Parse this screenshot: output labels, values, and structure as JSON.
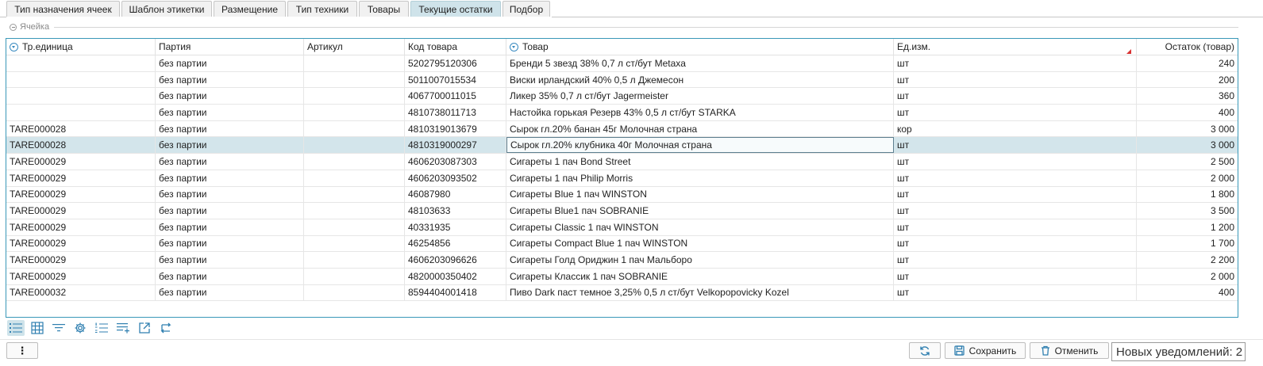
{
  "tabs": [
    {
      "label": "Тип назначения ячеек",
      "active": false
    },
    {
      "label": "Шаблон этикетки",
      "active": false
    },
    {
      "label": "Размещение",
      "active": false
    },
    {
      "label": "Тип техники",
      "active": false
    },
    {
      "label": "Товары",
      "active": false
    },
    {
      "label": "Текущие остатки",
      "active": true
    },
    {
      "label": "Подбор",
      "active": false
    }
  ],
  "group": {
    "label": "Ячейка"
  },
  "grid": {
    "columns": [
      "Тр.единица",
      "Партия",
      "Артикул",
      "Код товара",
      "Товар",
      "Ед.изм.",
      "Остаток (товар)"
    ],
    "rows": [
      {
        "tare": "",
        "batch": "без партии",
        "article": "",
        "code": "5202795120306",
        "product": "Бренди 5 звезд 38% 0,7 л ст/бут Metaxa",
        "unit": "шт",
        "qty": "240"
      },
      {
        "tare": "",
        "batch": "без партии",
        "article": "",
        "code": "5011007015534",
        "product": "Виски ирландский 40% 0,5 л Джемесон",
        "unit": "шт",
        "qty": "200"
      },
      {
        "tare": "",
        "batch": "без партии",
        "article": "",
        "code": "4067700011015",
        "product": "Ликер 35% 0,7 л ст/бут Jagermeister",
        "unit": "шт",
        "qty": "360"
      },
      {
        "tare": "",
        "batch": "без партии",
        "article": "",
        "code": "4810738011713",
        "product": "Настойка горькая Резерв 43% 0,5 л ст/бут STARKA",
        "unit": "шт",
        "qty": "400"
      },
      {
        "tare": "TARE000028",
        "batch": "без партии",
        "article": "",
        "code": "4810319013679",
        "product": "Сырок гл.20% банан 45г Молочная страна",
        "unit": "кор",
        "qty": "3 000"
      },
      {
        "tare": "TARE000028",
        "batch": "без партии",
        "article": "",
        "code": "4810319000297",
        "product": "Сырок гл.20% клубника 40г Молочная страна",
        "unit": "шт",
        "qty": "3 000"
      },
      {
        "tare": "TARE000029",
        "batch": "без партии",
        "article": "",
        "code": "4606203087303",
        "product": "Сигареты 1 пач Bond Street",
        "unit": "шт",
        "qty": "2 500"
      },
      {
        "tare": "TARE000029",
        "batch": "без партии",
        "article": "",
        "code": "4606203093502",
        "product": "Сигареты 1 пач Philip Morris",
        "unit": "шт",
        "qty": "2 000"
      },
      {
        "tare": "TARE000029",
        "batch": "без партии",
        "article": "",
        "code": "46087980",
        "product": "Сигареты Blue 1 пач WINSTON",
        "unit": "шт",
        "qty": "1 800"
      },
      {
        "tare": "TARE000029",
        "batch": "без партии",
        "article": "",
        "code": "48103633",
        "product": "Сигареты Blue1 пач SOBRANIE",
        "unit": "шт",
        "qty": "3 500"
      },
      {
        "tare": "TARE000029",
        "batch": "без партии",
        "article": "",
        "code": "40331935",
        "product": "Сигареты Classic 1 пач WINSTON",
        "unit": "шт",
        "qty": "1 200"
      },
      {
        "tare": "TARE000029",
        "batch": "без партии",
        "article": "",
        "code": "46254856",
        "product": "Сигареты Compact Blue 1 пач WINSTON",
        "unit": "шт",
        "qty": "1 700"
      },
      {
        "tare": "TARE000029",
        "batch": "без партии",
        "article": "",
        "code": "4606203096626",
        "product": "Сигареты Голд Ориджин 1 пач Мальборо",
        "unit": "шт",
        "qty": "2 200"
      },
      {
        "tare": "TARE000029",
        "batch": "без партии",
        "article": "",
        "code": "4820000350402",
        "product": "Сигареты Классик 1 пач SOBRANIE",
        "unit": "шт",
        "qty": "2 000"
      },
      {
        "tare": "TARE000032",
        "batch": "без партии",
        "article": "",
        "code": "8594404001418",
        "product": "Пиво Dark паст темное 3,25% 0,5 л ст/бут Velkopopovicky Kozel",
        "unit": "шт",
        "qty": "400"
      }
    ],
    "selected_row": 6,
    "focused_column": 5
  },
  "toolbar_icons": [
    "list-tree-icon",
    "grid-table-icon",
    "filter-icon",
    "settings-gear-icon",
    "numbered-list-icon",
    "add-row-icon",
    "export-icon",
    "swap-icon"
  ],
  "actions": {
    "menu_label": "⋮",
    "save_label": "Сохранить",
    "cancel_label": "Отменить"
  },
  "notifications": {
    "text": "Новых уведомлений: 2"
  },
  "colors": {
    "accent": "#3a98b8",
    "selected_row": "#d3e5eb",
    "active_tab": "#cfe3ea",
    "icon_blue": "#2f7fb0"
  }
}
